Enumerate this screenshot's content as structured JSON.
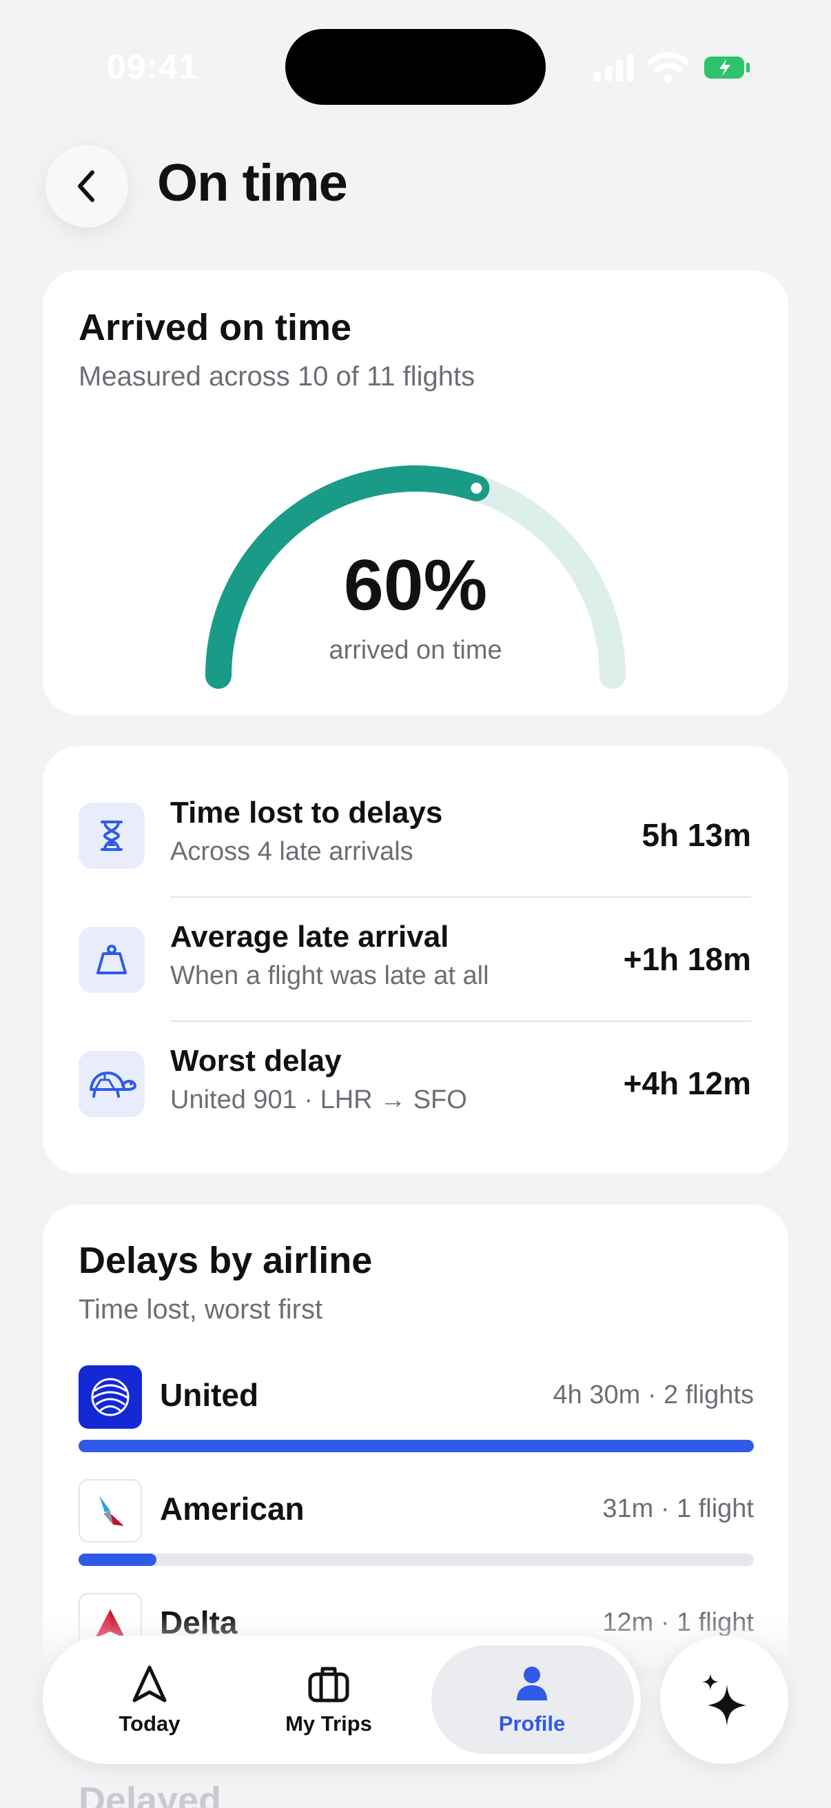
{
  "status_bar": {
    "time": "09:41"
  },
  "header": {
    "title": "On time"
  },
  "on_time_card": {
    "title": "Arrived on time",
    "subtitle": "Measured across 10 of 11 flights",
    "percent_value": 0.6,
    "percent_label": "60%",
    "percent_caption": "arrived on time",
    "colors": {
      "accent": "#1a9b88",
      "track": "#dcefeb"
    }
  },
  "stats": [
    {
      "icon": "hourglass-icon",
      "title": "Time lost to delays",
      "subtitle": "Across 4 late arrivals",
      "value": "5h 13m"
    },
    {
      "icon": "weight-icon",
      "title": "Average late arrival",
      "subtitle": "When a flight was late at all",
      "value": "+1h 18m"
    },
    {
      "icon": "turtle-icon",
      "title": "Worst delay",
      "subtitle": "United 901 · LHR → SFO",
      "value": "+4h 12m"
    }
  ],
  "airlines_card": {
    "title": "Delays by airline",
    "subtitle": "Time lost, worst first",
    "airlines": [
      {
        "name": "United",
        "meta": "4h 30m · 2 flights",
        "share": 1.0
      },
      {
        "name": "American",
        "meta": "31m · 1 flight",
        "share": 0.115
      },
      {
        "name": "Delta",
        "meta": "12m · 1 flight",
        "share": 0.045
      }
    ],
    "bar_color": "#2f5ae8"
  },
  "next_section_title": "Delayed",
  "tab_bar": {
    "tabs": [
      {
        "label": "Today",
        "icon": "navigation-arrow-icon"
      },
      {
        "label": "My Trips",
        "icon": "suitcase-icon"
      },
      {
        "label": "Profile",
        "icon": "person-icon",
        "active": true
      }
    ],
    "assistant_icon": "sparkles-icon"
  }
}
